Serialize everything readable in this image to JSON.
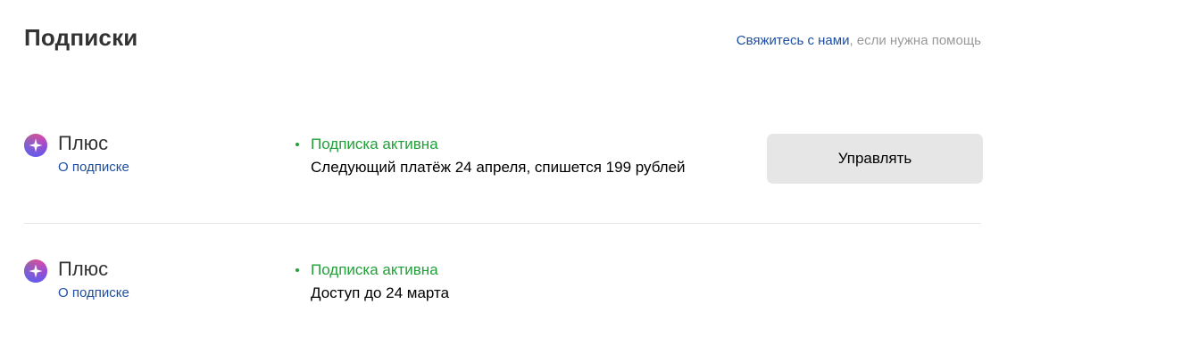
{
  "header": {
    "title": "Подписки",
    "help_link": "Свяжитесь с нами",
    "help_suffix": ", если нужна помощь"
  },
  "subscriptions": [
    {
      "icon": "plus-logo-icon",
      "name": "Плюс",
      "about_link": "О подписке",
      "status": "Подписка активна",
      "detail": "Следующий платёж 24 апреля, спишется 199 рублей",
      "action_label": "Управлять"
    },
    {
      "icon": "plus-logo-icon",
      "name": "Плюс",
      "about_link": "О подписке",
      "status": "Подписка активна",
      "detail": "Доступ до 24 марта"
    }
  ],
  "colors": {
    "link": "#1f4fa0",
    "status_active": "#21a038",
    "button_bg": "#e6e6e6",
    "muted_text": "#999999"
  }
}
